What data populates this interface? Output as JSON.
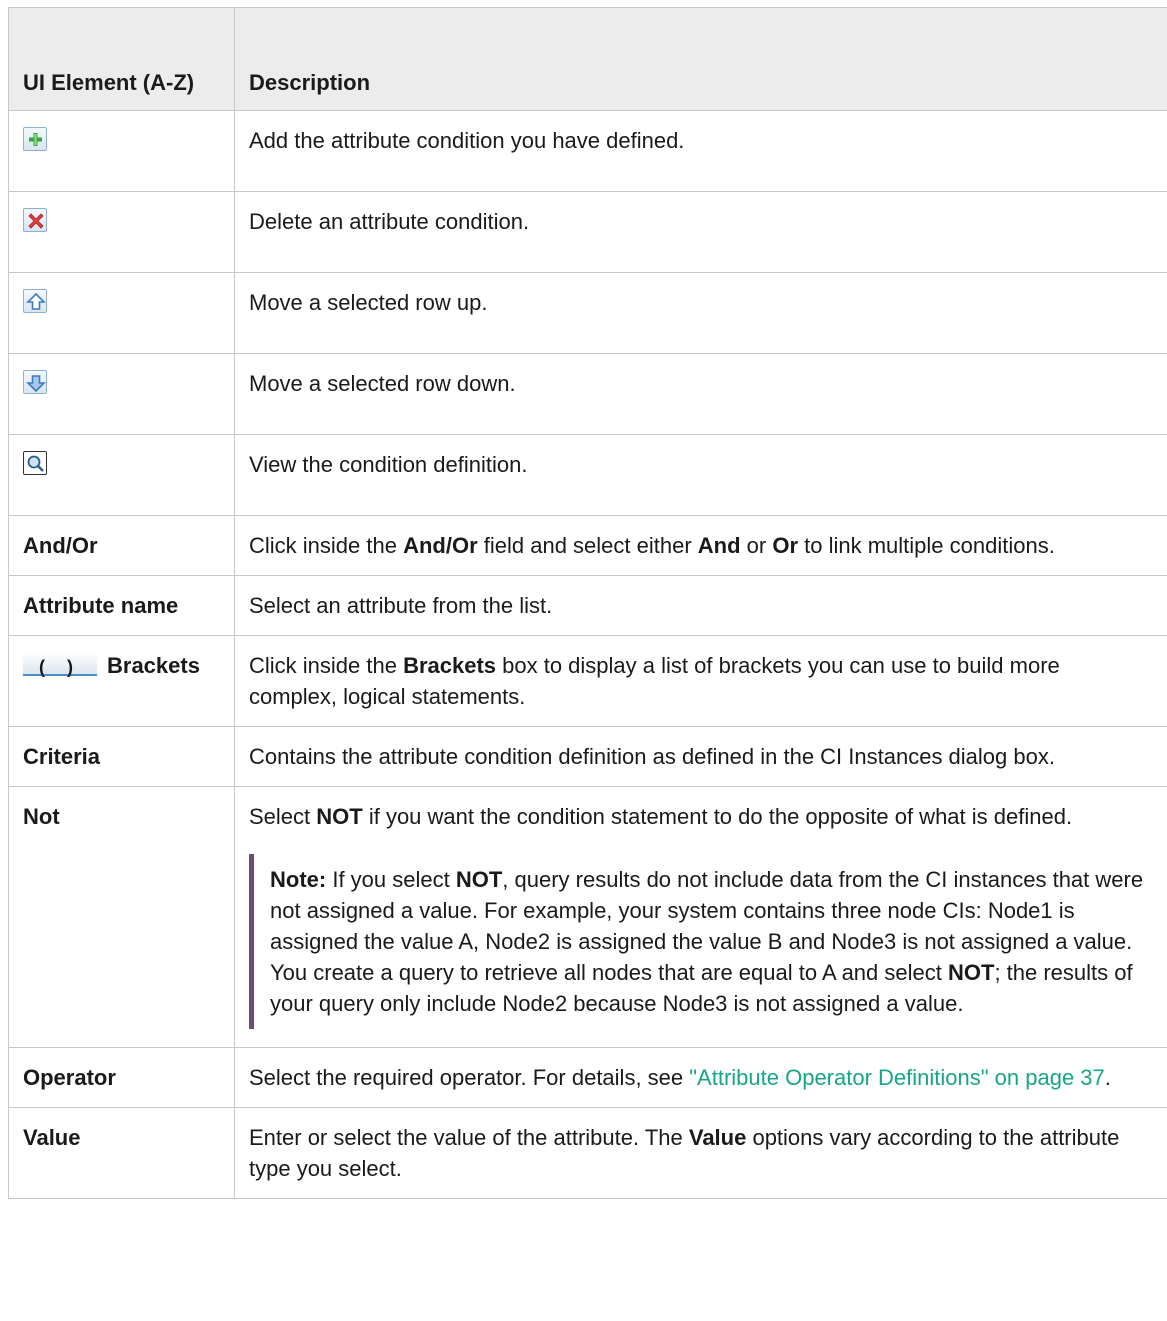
{
  "header": {
    "col1": "UI Element (A-Z)",
    "col2": "Description"
  },
  "rows": [
    {
      "icon": "add-icon",
      "desc": "Add the attribute condition you have defined."
    },
    {
      "icon": "delete-icon",
      "desc": "Delete an attribute condition."
    },
    {
      "icon": "move-up-icon",
      "desc": "Move a selected row up."
    },
    {
      "icon": "move-down-icon",
      "desc": "Move a selected row down."
    },
    {
      "icon": "view-magnifier-icon",
      "desc": "View the condition definition."
    }
  ],
  "and_or": {
    "label": "And/Or",
    "t1": "Click inside the ",
    "b1": "And/Or",
    "t2": " field and select either ",
    "b2": "And",
    "t3": " or ",
    "b3": "Or",
    "t4": " to link multiple conditions."
  },
  "attribute_name": {
    "label": "Attribute name",
    "desc": "Select an attribute from the list."
  },
  "brackets": {
    "icon_left": "(",
    "icon_right": ")",
    "label": "Brackets",
    "t1": "Click inside the ",
    "b1": "Brackets",
    "t2": " box to display a list of brackets you can use to build more complex, logical statements."
  },
  "criteria": {
    "label": "Criteria",
    "desc": "Contains the attribute condition definition as defined in the CI Instances dialog box."
  },
  "not": {
    "label": "Not",
    "t1": "Select ",
    "b1": "NOT",
    "t2": " if you want the condition statement to do the opposite of what is defined.",
    "note_label": "Note:",
    "n1": " If you select ",
    "nb1": "NOT",
    "n2": ", query results do not include data from the CI instances that were not assigned a value. For example, your system contains three node CIs: Node1 is assigned the value A, Node2 is assigned the value B and Node3 is not assigned a value. You create a query to retrieve all nodes that are equal to A and select ",
    "nb2": "NOT",
    "n3": "; the results of your query only include Node2 because Node3 is not assigned a value."
  },
  "operator": {
    "label": "Operator",
    "t1": "Select the required operator. For details, see ",
    "link": "\"Attribute Operator Definitions\" on page 37",
    "t2": "."
  },
  "value": {
    "label": "Value",
    "t1": "Enter or select the value of the attribute. The ",
    "b1": "Value",
    "t2": " options vary according to the attribute type you select."
  },
  "colors": {
    "header_bg": "#ececec",
    "border": "#c8c8c8",
    "link": "#17a589",
    "note_bar": "#6b4c7b"
  }
}
